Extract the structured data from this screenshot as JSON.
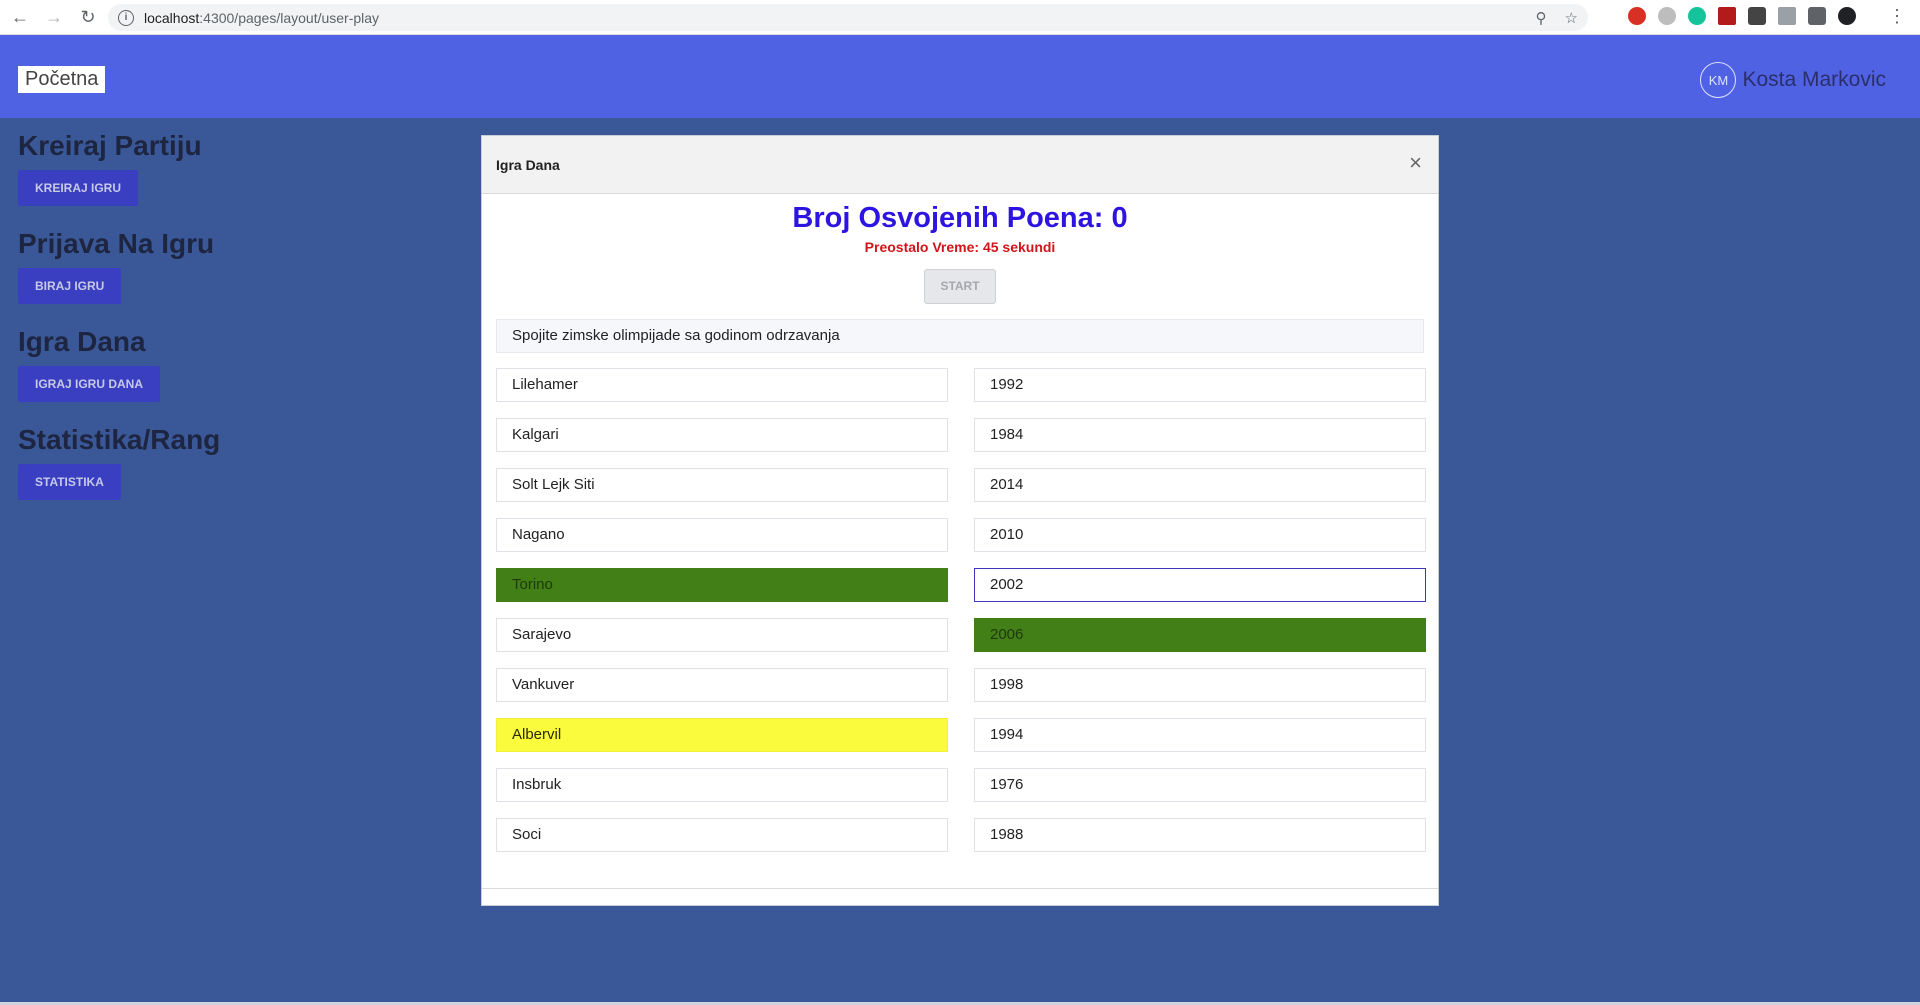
{
  "browser": {
    "url_host": "localhost",
    "url_rest": ":4300/pages/layout/user-play"
  },
  "header": {
    "home_label": "Početna",
    "avatar_initials": "KM",
    "user_name": "Kosta Markovic"
  },
  "sidebar": {
    "sections": [
      {
        "title": "Kreiraj Partiju",
        "button": "KREIRAJ IGRU"
      },
      {
        "title": "Prijava Na Igru",
        "button": "BIRAJ IGRU"
      },
      {
        "title": "Igra Dana",
        "button": "IGRAJ IGRU DANA"
      },
      {
        "title": "Statistika/Rang",
        "button": "STATISTIKA"
      }
    ]
  },
  "modal": {
    "title": "Igra Dana",
    "close_label": "×",
    "score_text": "Broj Osvojenih Poena: 0",
    "timer_text": "Preostalo Vreme: 45 sekundi",
    "start_label": "START",
    "question": "Spojite zimske olimpijade sa godinom odrzavanja",
    "left": [
      "Lilehamer",
      "Kalgari",
      "Solt Lejk Siti",
      "Nagano",
      "Torino",
      "Sarajevo",
      "Vankuver",
      "Albervil",
      "Insbruk",
      "Soci"
    ],
    "right": [
      "1992",
      "1984",
      "2014",
      "2010",
      "2002",
      "2006",
      "1998",
      "1994",
      "1976",
      "1988"
    ]
  },
  "colors": {
    "header_bg": "#5062e4",
    "page_bg": "#3a5898",
    "matched_green": "#427f17",
    "selected_yellow": "#f9fb3c",
    "score_color": "#2d14e0",
    "timer_color": "#d0151b"
  }
}
